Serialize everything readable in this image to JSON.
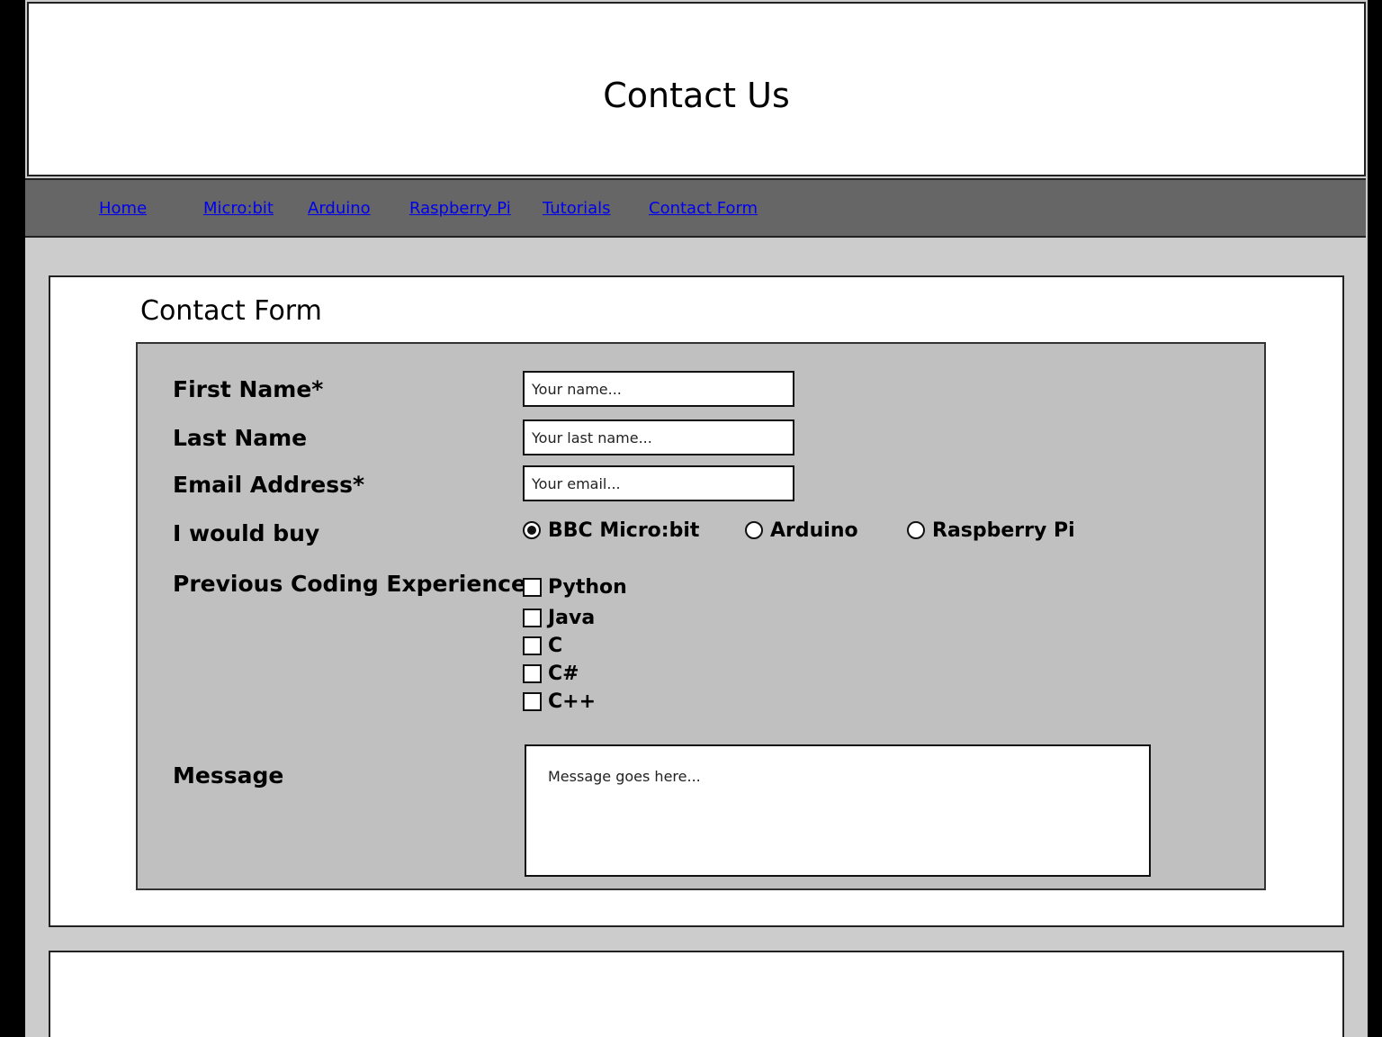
{
  "header": {
    "title": "Contact Us"
  },
  "nav": {
    "items": [
      {
        "label": "Home"
      },
      {
        "label": "Micro:bit"
      },
      {
        "label": "Arduino"
      },
      {
        "label": "Raspberry Pi"
      },
      {
        "label": "Tutorials"
      },
      {
        "label": "Contact Form"
      }
    ],
    "link_color": "#0000ee",
    "bar_color": "#666666"
  },
  "form": {
    "title": "Contact Form",
    "first_name": {
      "label": "First Name*",
      "placeholder": "Your name...",
      "value": ""
    },
    "last_name": {
      "label": "Last Name",
      "placeholder": "Your last name...",
      "value": ""
    },
    "email": {
      "label": "Email Address*",
      "placeholder": "Your email...",
      "value": ""
    },
    "buy": {
      "label": "I would buy",
      "options": [
        {
          "label": "BBC Micro:bit",
          "selected": true
        },
        {
          "label": "Arduino",
          "selected": false
        },
        {
          "label": "Raspberry Pi",
          "selected": false
        }
      ]
    },
    "experience": {
      "label": "Previous Coding Experience",
      "options": [
        {
          "label": "Python",
          "checked": false
        },
        {
          "label": "Java",
          "checked": false
        },
        {
          "label": "C",
          "checked": false
        },
        {
          "label": "C#",
          "checked": false
        },
        {
          "label": "C++",
          "checked": false
        }
      ]
    },
    "message": {
      "label": "Message",
      "placeholder": "Message goes here...",
      "value": ""
    },
    "box_color": "#c0c0c0"
  },
  "page_background": "#cccccc"
}
